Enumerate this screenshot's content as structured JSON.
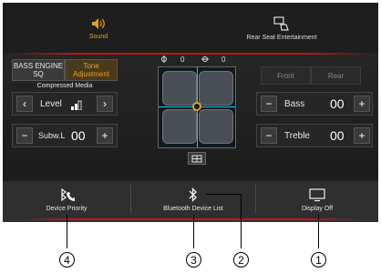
{
  "top_tabs": {
    "sound": "Sound",
    "rear_seat": "Rear Seat Entertainment"
  },
  "tone_panel": {
    "bass_engine": "BASS ENGINE SQ",
    "tone_adjust": "Tone Adjustment",
    "compressed_media": "Compressed Media",
    "level_label": "Level",
    "subw_label": "Subw.L",
    "subw_value": "00"
  },
  "position_readout": {
    "horizontal": "0",
    "vertical": "0"
  },
  "right_panel": {
    "front": "Front",
    "rear": "Rear",
    "bass_label": "Bass",
    "bass_value": "00",
    "treble_label": "Treble",
    "treble_value": "00"
  },
  "bottom_bar": {
    "device_priority": "Device Priority",
    "bt_list": "Bluetooth Device List",
    "display_off": "Display Off"
  },
  "callouts": [
    "4",
    "3",
    "2",
    "1"
  ]
}
